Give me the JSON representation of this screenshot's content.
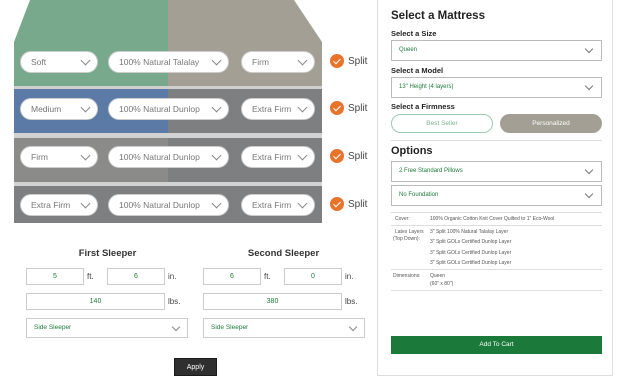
{
  "mattress": {
    "layers": [
      {
        "left_value": "Soft",
        "center_value": "100% Natural Talalay",
        "right_value": "Firm",
        "split_label": "Split"
      },
      {
        "left_value": "Medium",
        "center_value": "100% Natural Dunlop",
        "right_value": "Extra Firm",
        "split_label": "Split"
      },
      {
        "left_value": "Firm",
        "center_value": "100% Natural Dunlop",
        "right_value": "Extra Firm",
        "split_label": "Split"
      },
      {
        "left_value": "Extra Firm",
        "center_value": "100% Natural Dunlop",
        "right_value": "Extra Firm",
        "split_label": "Split"
      }
    ],
    "colors": {
      "green": "#78a98c",
      "blue": "#5c7aa6",
      "gray_left": "#8b8c8a",
      "tan": "#a39f94",
      "gray": "#7d7f80",
      "accent": "#e8742b"
    }
  },
  "sleepers": {
    "first": {
      "title": "First Sleeper",
      "ft": "5",
      "ft_unit": "ft.",
      "in": "6",
      "in_unit": "in.",
      "lbs": "140",
      "lbs_unit": "lbs.",
      "position": "Side Sleeper"
    },
    "second": {
      "title": "Second Sleeper",
      "ft": "6",
      "ft_unit": "ft.",
      "in": "0",
      "in_unit": "in.",
      "lbs": "380",
      "lbs_unit": "lbs.",
      "position": "Side Sleeper"
    },
    "apply_label": "Apply"
  },
  "panel": {
    "title": "Select a Mattress",
    "size_label": "Select a Size",
    "size_value": "Queen",
    "model_label": "Select a Model",
    "model_value": "13\" Height (4 layers)",
    "firmness_label": "Select a Firmness",
    "firmness_options": [
      "Best Seller",
      "Personalized"
    ],
    "options_title": "Options",
    "pillows_value": "2 Free Standard Pillows",
    "foundation_value": "No Foundation",
    "cover_label": "Cover:",
    "cover_value": "100% Organic Cotton Knit Cover Quilted to 1\" Eco-Wool",
    "latex_label_1": "Latex Layers",
    "latex_label_2": "(Top Down):",
    "latex_values": [
      "3\" Split 100% Natural Talalay Layer",
      "3\" Split GOLs Certified Dunlop Layer",
      "3\" Split GOLs Certified Dunlop Layer",
      "3\" Split GOLs Certified Dunlop Layer"
    ],
    "dimensions_label": "Dimensions:",
    "dimensions_value_1": "Queen",
    "dimensions_value_2": "(60\" x 80\")",
    "cart_label": "Add To Cart"
  }
}
